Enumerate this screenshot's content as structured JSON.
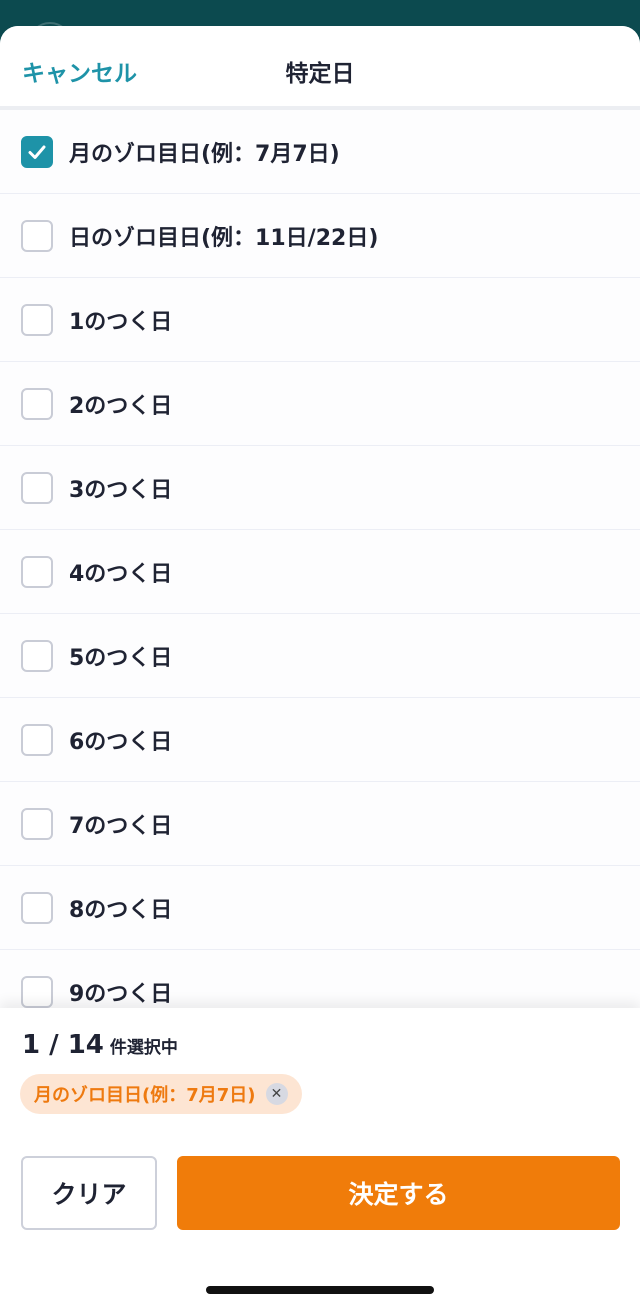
{
  "header": {
    "cancel_label": "キャンセル",
    "title": "特定日"
  },
  "options": [
    {
      "label": "月のゾロ目日(例：7月7日)",
      "checked": true
    },
    {
      "label": "日のゾロ目日(例：11日/22日)",
      "checked": false
    },
    {
      "label": "1のつく日",
      "checked": false
    },
    {
      "label": "2のつく日",
      "checked": false
    },
    {
      "label": "3のつく日",
      "checked": false
    },
    {
      "label": "4のつく日",
      "checked": false
    },
    {
      "label": "5のつく日",
      "checked": false
    },
    {
      "label": "6のつく日",
      "checked": false
    },
    {
      "label": "7のつく日",
      "checked": false
    },
    {
      "label": "8のつく日",
      "checked": false
    },
    {
      "label": "9のつく日",
      "checked": false
    }
  ],
  "footer": {
    "count": "1 / 14",
    "count_suffix": "件選択中",
    "chips": [
      {
        "label": "月のゾロ目日(例：7月7日)",
        "remove_icon": "close-icon"
      }
    ],
    "clear_label": "クリア",
    "submit_label": "決定する"
  },
  "colors": {
    "accent_teal": "#1e93a8",
    "accent_orange": "#f07c0a",
    "chip_bg": "#fde5d3",
    "backdrop": "#0c4a4f"
  }
}
